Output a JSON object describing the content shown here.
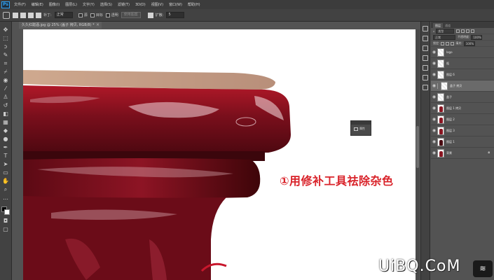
{
  "menubar": {
    "logo": "Ps",
    "items": [
      "文件(F)",
      "编辑(E)",
      "图像(I)",
      "图层(L)",
      "文字(Y)",
      "选择(S)",
      "滤镜(T)",
      "3D(D)",
      "视图(V)",
      "窗口(W)",
      "帮助(H)"
    ]
  },
  "options": {
    "patch_label": "补丁:",
    "patch_mode": "正常",
    "source_label": "源",
    "dest_label": "目标",
    "transparent_label": "透明",
    "use_pattern_label": "使用图案",
    "diffusion_label": "扩散:",
    "diffusion_value": "5"
  },
  "document": {
    "tab_title": "久久红醋酒.jpg @ 25% (盖子 拷贝, RGB/8) *",
    "tab_close": "×"
  },
  "canvas": {
    "annotation": "①用修补工具祛除杂色",
    "popup_label": "属性"
  },
  "layers": {
    "tabs": [
      "图层",
      "通道"
    ],
    "filter_label": "类型",
    "blend_mode": "正常",
    "opacity_label": "不透明度:",
    "opacity_value": "100%",
    "lock_label": "锁定:",
    "fill_label": "填充:",
    "fill_value": "100%",
    "items": [
      {
        "name": "logo"
      },
      {
        "name": "瓶"
      },
      {
        "name": "图层 6"
      },
      {
        "name": "盖子 拷贝"
      },
      {
        "name": "盖子"
      },
      {
        "name": "图层 1 拷贝"
      },
      {
        "name": "图层 2"
      },
      {
        "name": "图层 3"
      },
      {
        "name": "图层 1"
      },
      {
        "name": "背景"
      }
    ]
  },
  "watermark": {
    "text": "UiBQ.CoM",
    "badge": "≋"
  },
  "colors": {
    "accent_red": "#d9232a",
    "bottle_red": "#8a1622",
    "panel_bg": "#535353"
  }
}
